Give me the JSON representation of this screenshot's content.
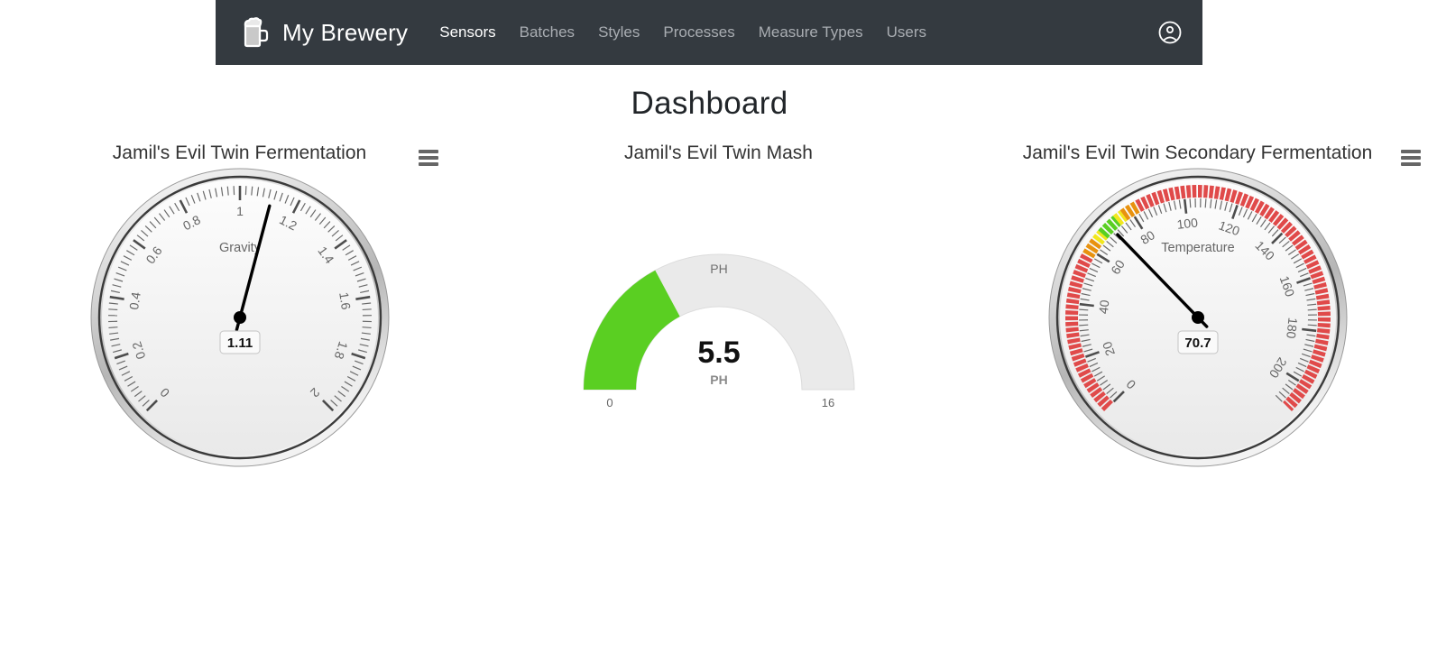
{
  "navbar": {
    "brand": "My Brewery",
    "brand_icon": "beer-mug-icon",
    "avatar_icon": "user-circle-icon",
    "background": "#343a40",
    "links": [
      {
        "label": "Sensors",
        "active": true
      },
      {
        "label": "Batches",
        "active": false
      },
      {
        "label": "Styles",
        "active": false
      },
      {
        "label": "Processes",
        "active": false
      },
      {
        "label": "Measure Types",
        "active": false
      },
      {
        "label": "Users",
        "active": false
      }
    ]
  },
  "page": {
    "title": "Dashboard"
  },
  "menu_icon": "hamburger-menu-icon",
  "chart_data": [
    {
      "type": "gauge",
      "style": "dial",
      "title": "Jamil's Evil Twin Fermentation",
      "pane_label": "Gravity",
      "value": 1.11,
      "value_text": "1.11",
      "unit": "",
      "min": 0,
      "max": 2,
      "tick_interval": 0.2,
      "tick_labels": [
        "0",
        "0.2",
        "0.4",
        "0.6",
        "0.8",
        "1",
        "1.2",
        "1.4",
        "1.6",
        "1.8",
        "2"
      ],
      "minor_tick_interval": 0.02,
      "start_angle": -135,
      "end_angle": 135,
      "bands": [],
      "dial_color": "#000000",
      "has_export_menu": true
    },
    {
      "type": "gauge",
      "style": "solid-arc",
      "title": "Jamil's Evil Twin Mash",
      "pane_label": "PH",
      "value": 5.5,
      "value_text": "5.5",
      "unit": "PH",
      "min": 0,
      "max": 16,
      "tick_labels": [
        "0",
        "16"
      ],
      "start_angle": -90,
      "end_angle": 90,
      "fill_color": "#5ACF22",
      "track_color": "#eaeaea",
      "has_export_menu": false
    },
    {
      "type": "gauge",
      "style": "dial",
      "title": "Jamil's Evil Twin Secondary Fermentation",
      "pane_label": "Temperature",
      "value": 70.7,
      "value_text": "70.7",
      "unit": "",
      "min": 0,
      "max": 210,
      "tick_interval": 20,
      "tick_labels": [
        "0",
        "20",
        "40",
        "60",
        "80",
        "100",
        "120",
        "140",
        "160",
        "180",
        "200"
      ],
      "minor_tick_interval": 2,
      "start_angle": -135,
      "end_angle": 135,
      "bands": [
        {
          "from": 0,
          "to": 58,
          "color": "#e04a4a"
        },
        {
          "from": 58,
          "to": 64,
          "color": "#e8920f"
        },
        {
          "from": 64,
          "to": 67,
          "color": "#f2e71c"
        },
        {
          "from": 67,
          "to": 74,
          "color": "#5ACF22"
        },
        {
          "from": 74,
          "to": 77,
          "color": "#f2e71c"
        },
        {
          "from": 77,
          "to": 83,
          "color": "#e8920f"
        },
        {
          "from": 83,
          "to": 210,
          "color": "#e04a4a"
        }
      ],
      "dial_color": "#000000",
      "has_export_menu": true
    }
  ]
}
